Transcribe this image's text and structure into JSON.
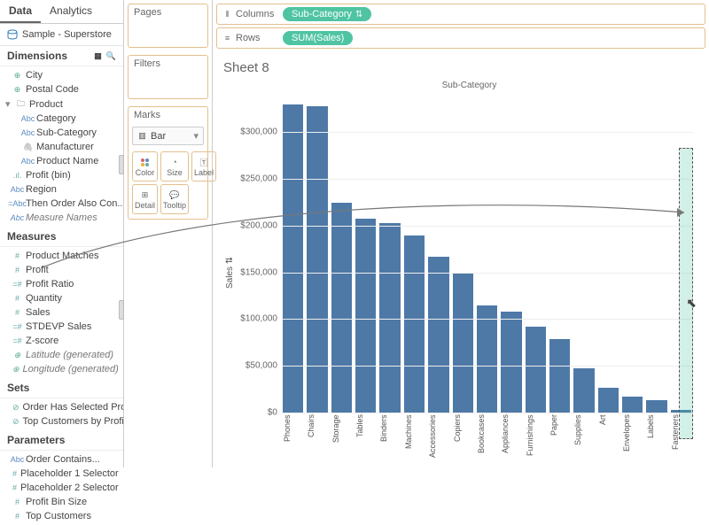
{
  "tabs": {
    "data": "Data",
    "analytics": "Analytics"
  },
  "datasource": "Sample - Superstore",
  "sections": {
    "dimensions": "Dimensions",
    "measures": "Measures",
    "sets": "Sets",
    "parameters": "Parameters"
  },
  "dimensions": {
    "city": "City",
    "postal": "Postal Code",
    "product": "Product",
    "category": "Category",
    "subcategory": "Sub-Category",
    "manufacturer": "Manufacturer",
    "productname": "Product Name",
    "profitbin": "Profit (bin)",
    "region": "Region",
    "thenorder": "Then Order Also Con...",
    "measurenames": "Measure Names"
  },
  "measures": {
    "productmatches": "Product Matches",
    "profit": "Profit",
    "profitratio": "Profit Ratio",
    "quantity": "Quantity",
    "sales": "Sales",
    "stdevp": "STDEVP Sales",
    "zscore": "Z-score",
    "lat": "Latitude (generated)",
    "lon": "Longitude (generated)"
  },
  "sets": {
    "orderhas": "Order Has Selected Pro...",
    "topcust": "Top Customers by Profit"
  },
  "parameters": {
    "ordercontains": "Order Contains...",
    "p1": "Placeholder 1 Selector",
    "p2": "Placeholder 2 Selector",
    "pbin": "Profit Bin Size",
    "topc": "Top Customers"
  },
  "midshelves": {
    "pages": "Pages",
    "filters": "Filters",
    "marks": "Marks"
  },
  "marktype": "Bar",
  "markcells": {
    "color": "Color",
    "size": "Size",
    "label": "Label",
    "detail": "Detail",
    "tooltip": "Tooltip"
  },
  "shelves": {
    "columns_label": "Columns",
    "rows_label": "Rows",
    "columns_pill": "Sub-Category",
    "rows_pill": "SUM(Sales)"
  },
  "sheet": {
    "title": "Sheet 8",
    "ylabel": "Sales",
    "header": "Sub-Category"
  },
  "chart_data": {
    "type": "bar",
    "title": "Sheet 8",
    "xlabel": "Sub-Category",
    "ylabel": "Sales",
    "ylim": [
      0,
      340000
    ],
    "yticks": [
      0,
      50000,
      100000,
      150000,
      200000,
      250000,
      300000
    ],
    "ytick_labels": [
      "$0",
      "$50,000",
      "$100,000",
      "$150,000",
      "$200,000",
      "$250,000",
      "$300,000"
    ],
    "categories": [
      "Phones",
      "Chairs",
      "Storage",
      "Tables",
      "Binders",
      "Machines",
      "Accessories",
      "Copiers",
      "Bookcases",
      "Appliances",
      "Furnishings",
      "Paper",
      "Supplies",
      "Art",
      "Envelopes",
      "Labels",
      "Fasteners"
    ],
    "values": [
      330000,
      328000,
      224000,
      207000,
      203000,
      189000,
      167000,
      150000,
      115000,
      108000,
      92000,
      79000,
      47000,
      27000,
      17000,
      13000,
      3000
    ]
  }
}
